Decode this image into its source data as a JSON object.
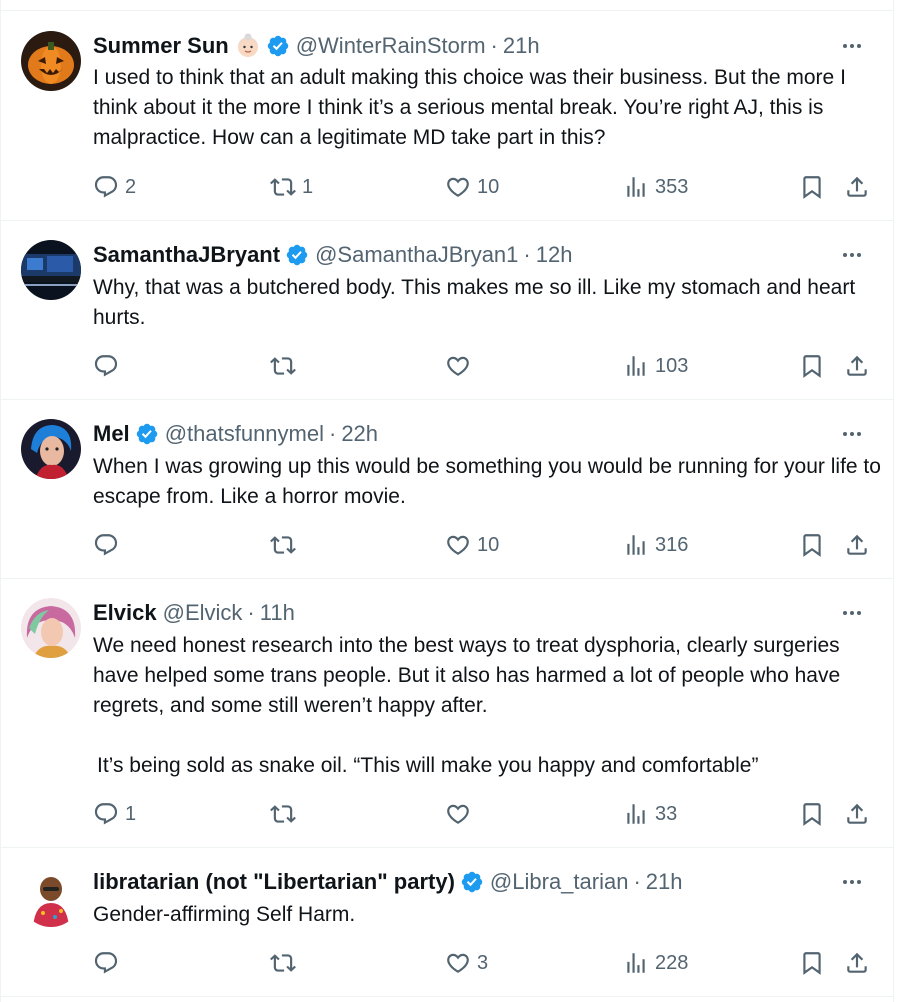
{
  "tweets": [
    {
      "name": "Summer Sun",
      "handle": "@WinterRainStorm",
      "time": "21h",
      "has_emoji": true,
      "verified": true,
      "text": "I used to think that an adult making this choice was their business. But the more I think about it the more I think it’s a serious mental break. You’re right AJ, this is malpractice. How can a legitimate MD take part in this?",
      "replies": "2",
      "retweets": "1",
      "likes": "10",
      "views": "353"
    },
    {
      "name": "SamanthaJBryant",
      "handle": "@SamanthaJBryan1",
      "time": "12h",
      "verified": true,
      "text": "Why, that was a butchered body. This makes me so ill. Like my stomach and heart hurts.",
      "replies": "",
      "retweets": "",
      "likes": "",
      "views": "103"
    },
    {
      "name": "Mel",
      "handle": "@thatsfunnymel",
      "time": "22h",
      "verified": true,
      "text": "When I was growing up this would be something you would be running for your life to escape from. Like a horror movie.",
      "replies": "",
      "retweets": "",
      "likes": "10",
      "views": "316"
    },
    {
      "name": "Elvick",
      "handle": "@Elvick",
      "time": "11h",
      "verified": false,
      "text": "We need honest research into the best ways to treat dysphoria, clearly surgeries have helped some trans people. But it also has harmed a lot of people who have regrets, and some still weren’t happy after.",
      "text2": "It’s being sold as snake oil. “This will make you happy and comfortable”",
      "replies": "1",
      "retweets": "",
      "likes": "",
      "views": "33"
    },
    {
      "name": "libratarian (not \"Libertarian\" party)",
      "handle": "@Libra_tarian",
      "time": "21h",
      "verified": true,
      "text": "Gender-affirming Self Harm.",
      "replies": "",
      "retweets": "",
      "likes": "3",
      "views": "228"
    }
  ],
  "separator": "·",
  "colors": {
    "verified": "#1d9bf0",
    "muted": "#536471",
    "text": "#0f1419",
    "border": "#eff3f4"
  },
  "icons": [
    "reply-icon",
    "retweet-icon",
    "like-icon",
    "views-icon",
    "bookmark-icon",
    "share-icon",
    "more-icon",
    "verified-badge-icon"
  ]
}
